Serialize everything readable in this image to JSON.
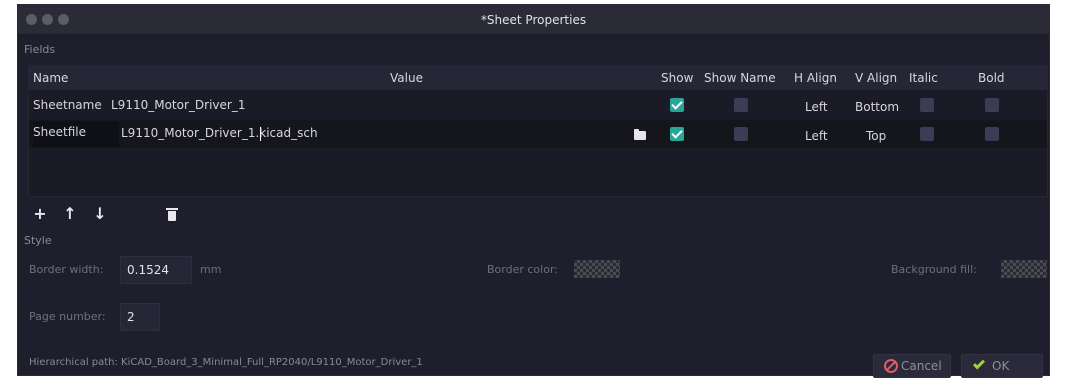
{
  "window": {
    "title": "*Sheet Properties"
  },
  "fields": {
    "section_label": "Fields",
    "columns": {
      "name": "Name",
      "value": "Value",
      "show": "Show",
      "show_name": "Show Name",
      "h_align": "H Align",
      "v_align": "V Align",
      "italic": "Italic",
      "bold": "Bold"
    },
    "rows": [
      {
        "name": "Sheetname",
        "value": "L9110_Motor_Driver_1",
        "show": true,
        "show_name": false,
        "h_align": "Left",
        "v_align": "Bottom",
        "italic": false,
        "bold": false
      },
      {
        "name": "Sheetfile",
        "value": "L9110_Motor_Driver_1.kicad_sch",
        "show": true,
        "show_name": false,
        "h_align": "Left",
        "v_align": "Top",
        "italic": false,
        "bold": false
      }
    ],
    "toolbar": {
      "add": "+",
      "move_up": "↑",
      "move_down": "↓"
    }
  },
  "style": {
    "section_label": "Style",
    "border_width_label": "Border width:",
    "border_width_value": "0.1524",
    "border_width_unit": "mm",
    "border_color_label": "Border color:",
    "background_fill_label": "Background fill:",
    "page_number_label": "Page number:",
    "page_number_value": "2"
  },
  "footer": {
    "hierarchical_path": "Hierarchical path: KiCAD_Board_3_Minimal_Full_RP2040/L9110_Motor_Driver_1",
    "cancel_label": "Cancel",
    "ok_label": "OK"
  },
  "colors": {
    "checkbox_on": "#27a79a",
    "checkbox_off": "#3a3d55",
    "cancel_icon": "#e05a6a",
    "ok_icon": "#9ed23a",
    "dialog_bg": "#1e1e2c"
  }
}
